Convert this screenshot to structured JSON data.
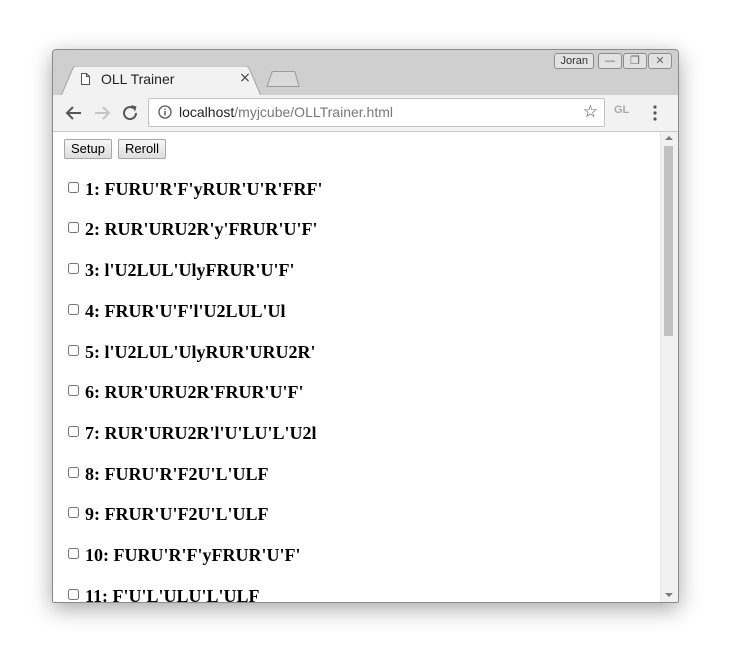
{
  "window": {
    "user_badge": "Joran",
    "minimize_glyph": "—",
    "restore_glyph": "❐",
    "close_glyph": "✕"
  },
  "tab": {
    "title": "OLL Trainer",
    "close_glyph": "×",
    "icon": "page-icon"
  },
  "toolbar": {
    "back_icon": "arrow-left-icon",
    "forward_icon": "arrow-right-icon",
    "reload_icon": "reload-icon",
    "url_host": "localhost",
    "url_path": "/myjcube/OLLTrainer.html",
    "star_glyph": "☆",
    "extension_label": "GL",
    "menu_icon": "kebab-menu-icon"
  },
  "page": {
    "setup_label": "Setup",
    "reroll_label": "Reroll",
    "algorithms": [
      "1: FURU'R'F'yRUR'U'R'FRF'",
      "2: RUR'URU2R'y'FRUR'U'F'",
      "3: l'U2LUL'UlyFRUR'U'F'",
      "4: FRUR'U'F'l'U2LUL'Ul",
      "5: l'U2LUL'UlyRUR'URU2R'",
      "6: RUR'URU2R'FRUR'U'F'",
      "7: RUR'URU2R'l'U'LU'L'U2l",
      "8: FURU'R'F2U'L'ULF",
      "9: FRUR'U'F2U'L'ULF",
      "10: FURU'R'F'yFRUR'U'F'",
      "11: F'U'L'ULU'L'ULF"
    ]
  }
}
